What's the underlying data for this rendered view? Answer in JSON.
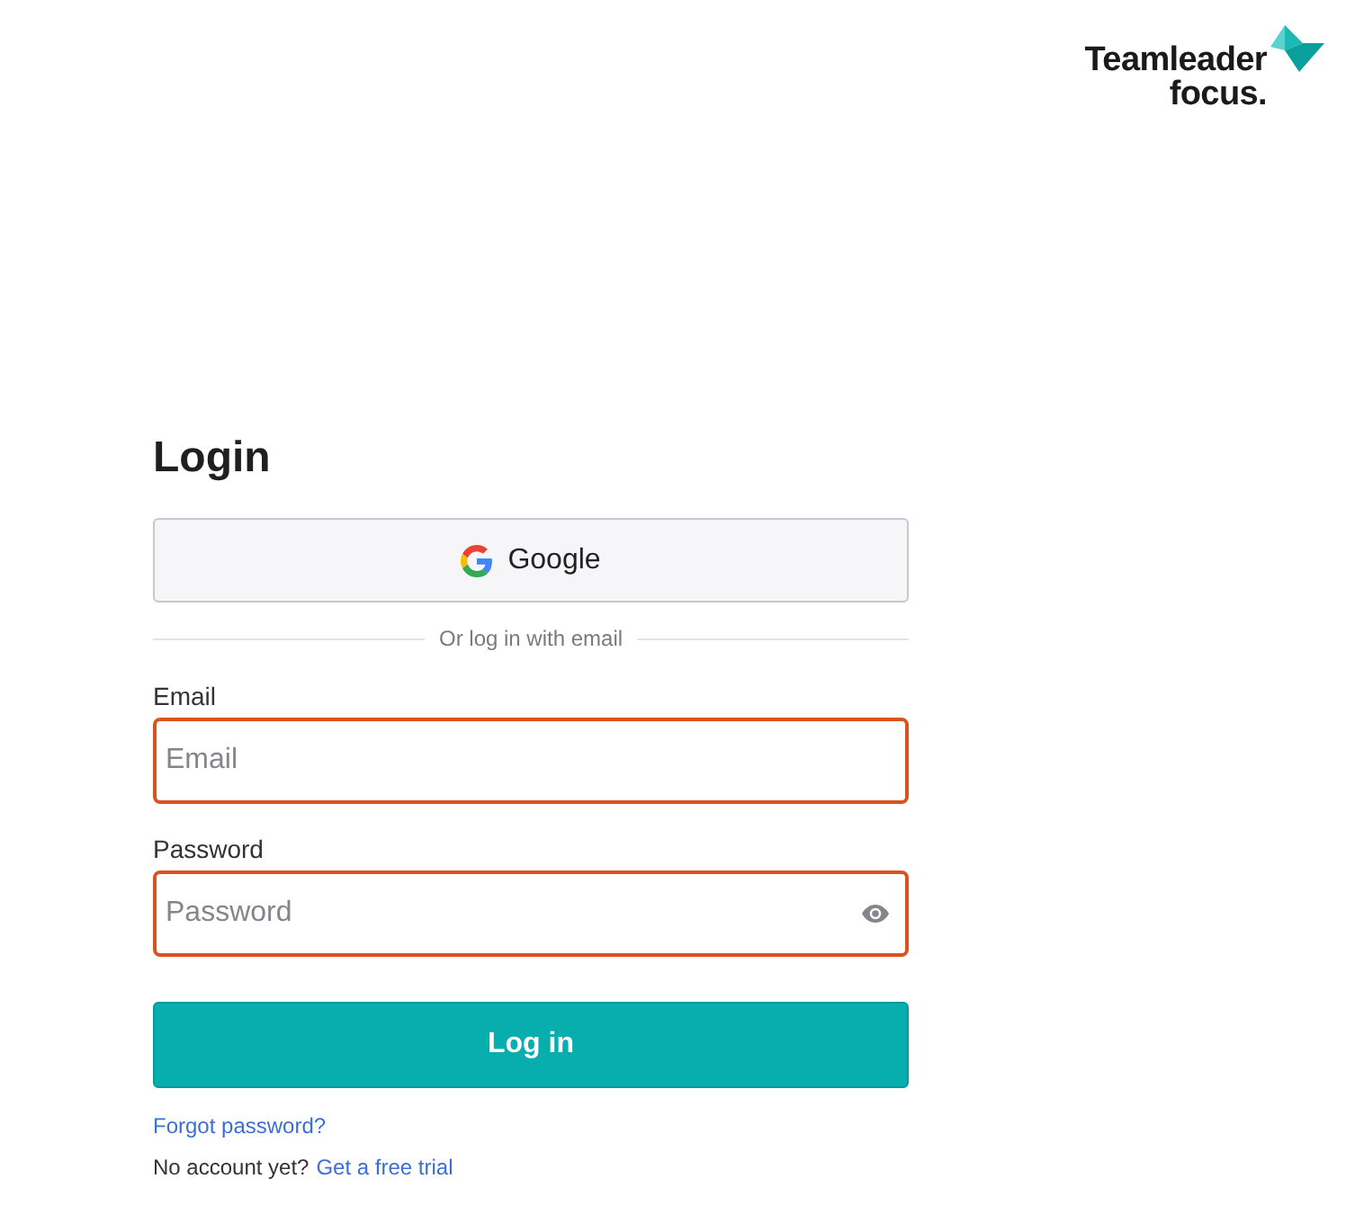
{
  "logo": {
    "line_1": "Teamleader",
    "line_2": "focus."
  },
  "title": "Login",
  "google_button": {
    "label": "Google"
  },
  "divider": "Or log in with email",
  "fields": [
    {
      "kind": "text",
      "label": "Email",
      "placeholder": "Email",
      "error": true
    },
    {
      "kind": "password",
      "label": "Password",
      "placeholder": "Password",
      "error": true
    }
  ],
  "submit": "Log in",
  "forgot_link": "Forgot password?",
  "signup": {
    "text": "No account yet?",
    "link": "Get a free trial"
  }
}
